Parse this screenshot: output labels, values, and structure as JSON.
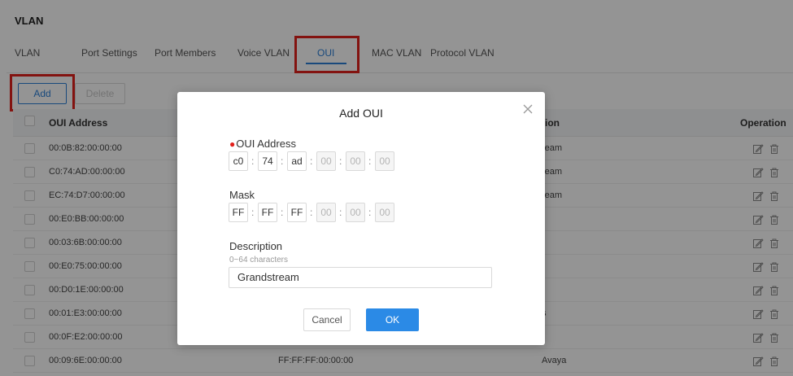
{
  "panel": {
    "title": "VLAN"
  },
  "tabs": [
    {
      "label": "VLAN",
      "active": false
    },
    {
      "label": "Port Settings",
      "active": false
    },
    {
      "label": "Port Members",
      "active": false
    },
    {
      "label": "Voice VLAN",
      "active": false
    },
    {
      "label": "OUI",
      "active": true
    },
    {
      "label": "MAC VLAN",
      "active": false
    },
    {
      "label": "Protocol VLAN",
      "active": false
    }
  ],
  "toolbar": {
    "add_label": "Add",
    "delete_label": "Delete"
  },
  "table": {
    "headers": {
      "oui_address": "OUI Address",
      "description": "tion",
      "operation": "Operation"
    },
    "rows": [
      {
        "oui": "00:0B:82:00:00:00",
        "mask": "",
        "description": "ream"
      },
      {
        "oui": "C0:74:AD:00:00:00",
        "mask": "",
        "description": "ream"
      },
      {
        "oui": "EC:74:D7:00:00:00",
        "mask": "",
        "description": "ream"
      },
      {
        "oui": "00:E0:BB:00:00:00",
        "mask": "",
        "description": ""
      },
      {
        "oui": "00:03:6B:00:00:00",
        "mask": "",
        "description": ""
      },
      {
        "oui": "00:E0:75:00:00:00",
        "mask": "",
        "description": ""
      },
      {
        "oui": "00:D0:1E:00:00:00",
        "mask": "",
        "description": ""
      },
      {
        "oui": "00:01:E3:00:00:00",
        "mask": "",
        "description": "s"
      },
      {
        "oui": "00:0F:E2:00:00:00",
        "mask": "",
        "description": ""
      },
      {
        "oui": "00:09:6E:00:00:00",
        "mask": "FF:FF:FF:00:00:00",
        "description": "Avaya"
      }
    ]
  },
  "modal": {
    "title": "Add OUI",
    "oui_label": "OUI Address",
    "oui_values": [
      "c0",
      "74",
      "ad",
      "00",
      "00",
      "00"
    ],
    "mask_label": "Mask",
    "mask_values": [
      "FF",
      "FF",
      "FF",
      "00",
      "00",
      "00"
    ],
    "description_label": "Description",
    "description_hint": "0~64 characters",
    "description_value": "Grandstream",
    "cancel_label": "Cancel",
    "ok_label": "OK"
  },
  "colors": {
    "accent": "#2b7fd6",
    "highlight": "#e2211c",
    "ok_button": "#2b8ae6"
  },
  "icons": [
    "close-icon",
    "edit-icon",
    "trash-icon"
  ]
}
